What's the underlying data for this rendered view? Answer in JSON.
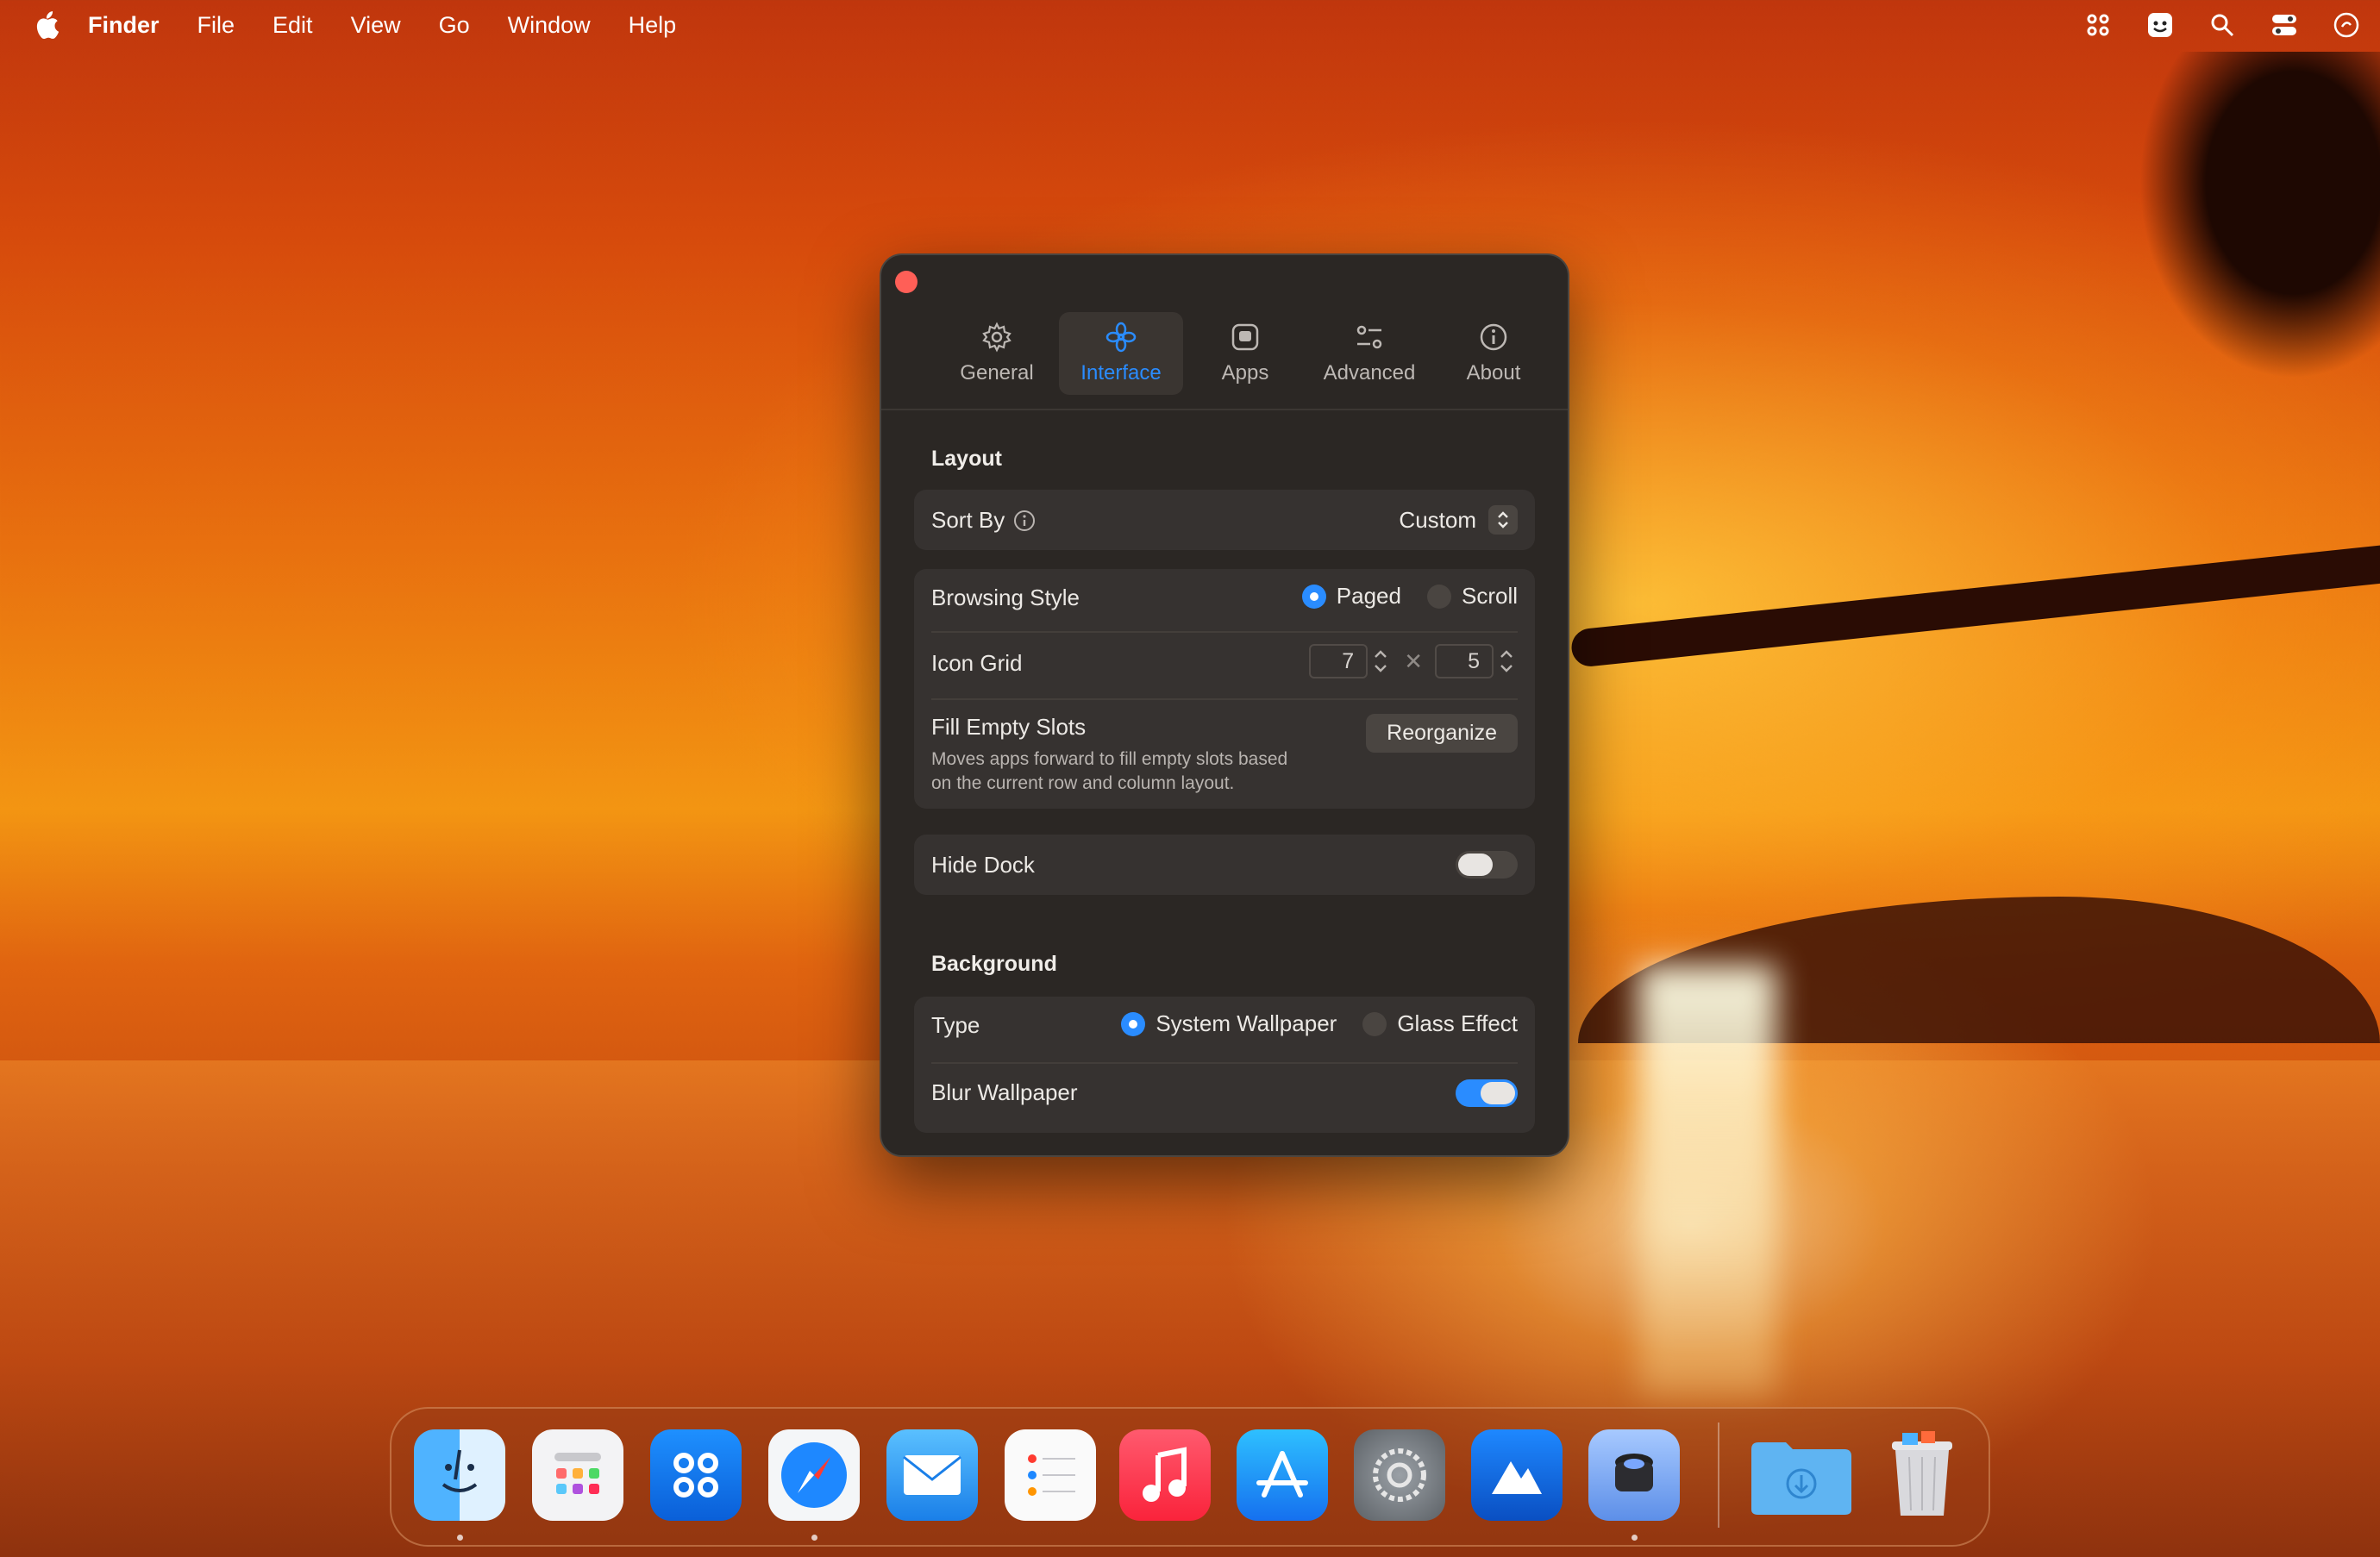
{
  "menubar": {
    "app_name": "Finder",
    "items": [
      "File",
      "Edit",
      "View",
      "Go",
      "Window",
      "Help"
    ],
    "status_icons": [
      "launchpad-icon",
      "memoji-icon",
      "search-icon",
      "control-center-icon",
      "siri-icon"
    ]
  },
  "window": {
    "tabs": [
      {
        "label": "General",
        "icon": "gear-icon",
        "active": false
      },
      {
        "label": "Interface",
        "icon": "flower-icon",
        "active": true
      },
      {
        "label": "Apps",
        "icon": "app-square-icon",
        "active": false
      },
      {
        "label": "Advanced",
        "icon": "sliders-icon",
        "active": false
      },
      {
        "label": "About",
        "icon": "info-icon",
        "active": false
      }
    ],
    "layout": {
      "title": "Layout",
      "sort_by_label": "Sort By",
      "sort_by_value": "Custom",
      "browsing_style_label": "Browsing Style",
      "browsing_options": [
        "Paged",
        "Scroll"
      ],
      "browsing_selected": "Paged",
      "icon_grid_label": "Icon Grid",
      "icon_grid_columns": "7",
      "icon_grid_times": "✕",
      "icon_grid_rows": "5",
      "fill_empty_label": "Fill Empty Slots",
      "fill_empty_desc_1": "Moves apps forward to fill empty slots based",
      "fill_empty_desc_2": "on the current row and column layout.",
      "reorganize_button": "Reorganize",
      "hide_dock_label": "Hide Dock",
      "hide_dock_on": false
    },
    "background": {
      "title": "Background",
      "type_label": "Type",
      "type_options": [
        "System Wallpaper",
        "Glass Effect"
      ],
      "type_selected": "System Wallpaper",
      "blur_label": "Blur Wallpaper",
      "blur_on": true
    }
  },
  "dock": {
    "apps": [
      "Finder",
      "Launchpad",
      "Launcher",
      "Safari",
      "Mail",
      "Reminders",
      "Music",
      "App Store",
      "System Settings",
      "Sky",
      "Lens",
      "Downloads",
      "Trash"
    ],
    "running": [
      "Finder",
      "Safari",
      "Lens"
    ]
  },
  "colors": {
    "accent": "#2a8cff",
    "window_bg": "#2b2724",
    "card_bg": "#363230",
    "close": "#ff5f57"
  }
}
